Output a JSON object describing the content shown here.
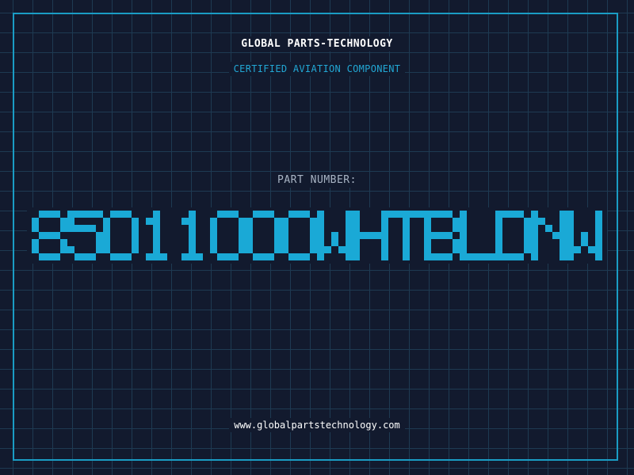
{
  "header": {
    "company": "GLOBAL PARTS-TECHNOLOGY",
    "subtitle": "CERTIFIED AVIATION COMPONENT"
  },
  "part": {
    "label": "PART NUMBER:",
    "number": "85011000WHTBLDNW",
    "digit_color": "#1aa9d6"
  },
  "footer": {
    "website": "www.globalpartstechnology.com"
  },
  "colors": {
    "background": "#121a2e",
    "grid": "#1e3a52",
    "frame": "#1a9cc4",
    "accent": "#22a7d4"
  }
}
